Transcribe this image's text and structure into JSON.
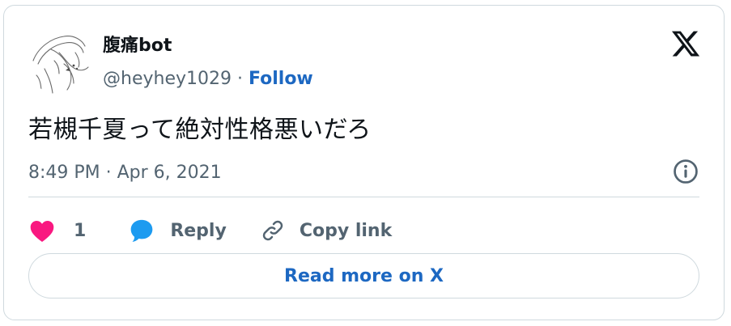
{
  "tweet": {
    "author": {
      "display_name": "腹痛bot",
      "handle": "@heyhey1029",
      "separator": "·",
      "follow_label": "Follow"
    },
    "text": "若槻千夏って絶対性格悪いだろ",
    "timestamp": "8:49 PM · Apr 6, 2021",
    "actions": {
      "like_count": "1",
      "reply_label": "Reply",
      "copy_link_label": "Copy link"
    },
    "read_more_label": "Read more on X"
  },
  "icons": {
    "logo": "x-logo-icon",
    "info": "info-icon",
    "like": "heart-icon",
    "reply": "speech-bubble-icon",
    "copy_link": "link-icon"
  },
  "colors": {
    "text": "#0f1419",
    "secondary_text": "#536471",
    "link_blue": "#1d68c2",
    "like_pink": "#f91880",
    "reply_blue": "#1d9bf0",
    "border": "#cfd9de"
  }
}
